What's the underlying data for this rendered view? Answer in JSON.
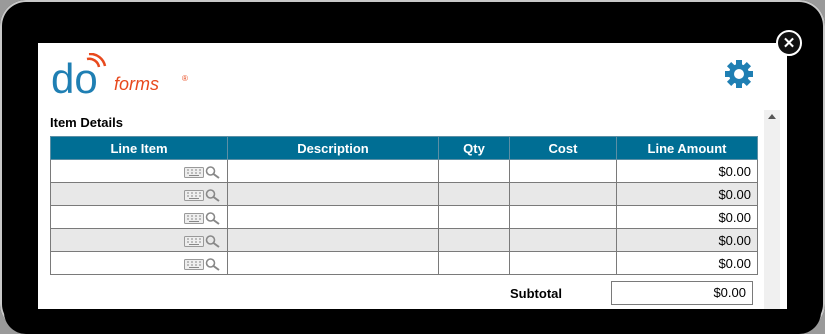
{
  "app": {
    "logo_text_do": "do",
    "logo_text_forms": "forms",
    "logo_mark": "®"
  },
  "section": {
    "title": "Item Details"
  },
  "table": {
    "headers": [
      "Line Item",
      "Description",
      "Qty",
      "Cost",
      "Line Amount"
    ],
    "rows": [
      {
        "line_item": "",
        "description": "",
        "qty": "",
        "cost": "",
        "line_amount": "$0.00"
      },
      {
        "line_item": "",
        "description": "",
        "qty": "",
        "cost": "",
        "line_amount": "$0.00"
      },
      {
        "line_item": "",
        "description": "",
        "qty": "",
        "cost": "",
        "line_amount": "$0.00"
      },
      {
        "line_item": "",
        "description": "",
        "qty": "",
        "cost": "",
        "line_amount": "$0.00"
      },
      {
        "line_item": "",
        "description": "",
        "qty": "",
        "cost": "",
        "line_amount": "$0.00"
      }
    ]
  },
  "subtotal": {
    "label": "Subtotal",
    "value": "$0.00"
  },
  "icons": {
    "close": "close-icon",
    "settings": "gear-icon",
    "keyboard": "keyboard-icon",
    "search": "search-icon"
  },
  "colors": {
    "header_bg": "#006e94",
    "logo_blue": "#1f7fb3",
    "logo_orange": "#e8491d",
    "alt_row": "#e8e8e8"
  }
}
